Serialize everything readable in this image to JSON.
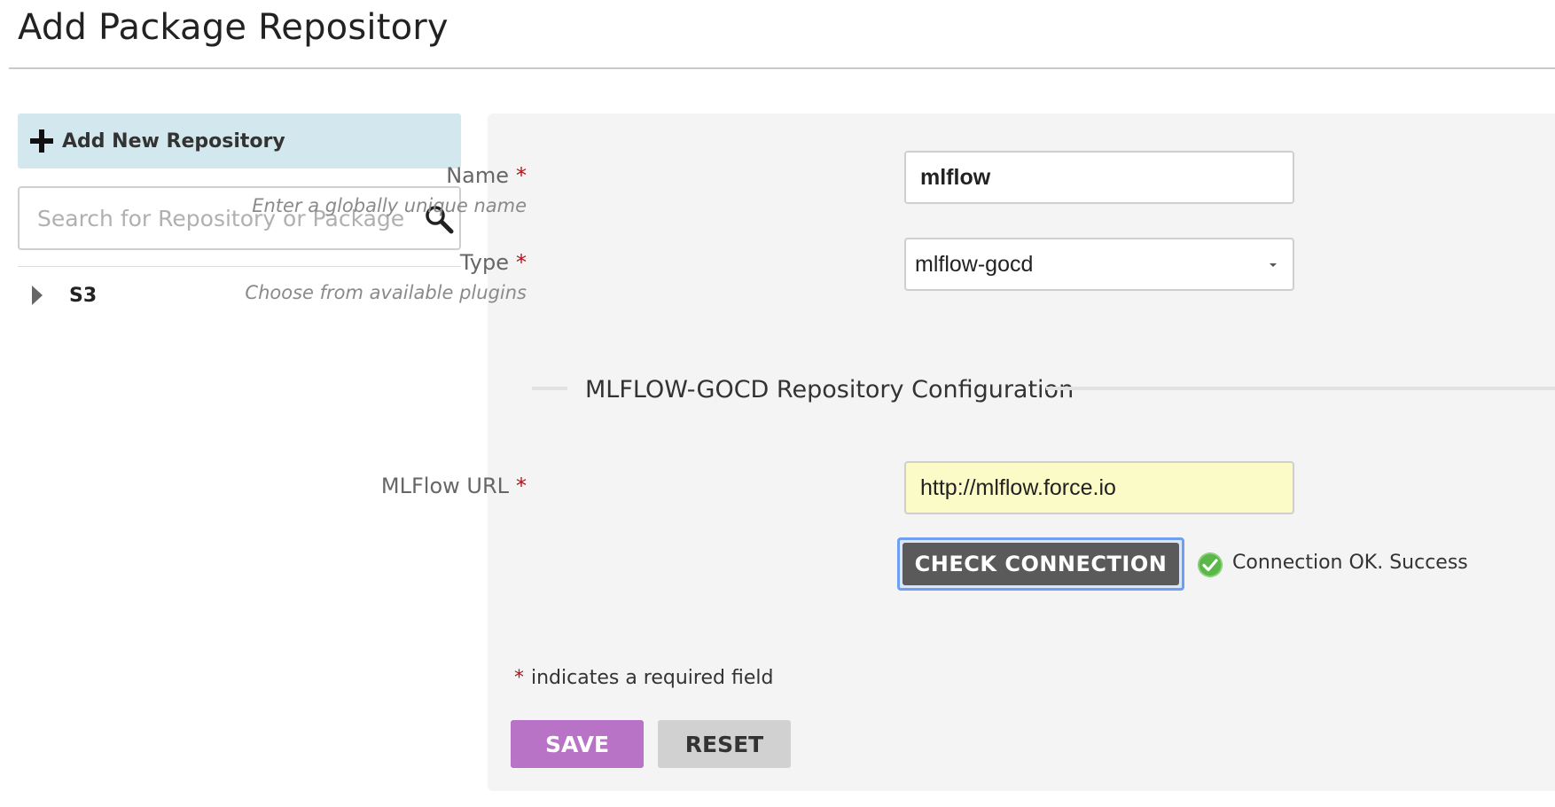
{
  "page": {
    "title": "Add Package Repository"
  },
  "sidebar": {
    "add_new_label": "Add New Repository",
    "search_placeholder": "Search for Repository or Package",
    "search_value": "",
    "tree": [
      {
        "label": "S3",
        "expanded": false
      }
    ]
  },
  "form": {
    "name": {
      "label": "Name",
      "required_marker": "*",
      "hint": "Enter a globally unique name",
      "value": "mlflow"
    },
    "type": {
      "label": "Type",
      "required_marker": "*",
      "hint": "Choose from available plugins",
      "selected": "mlflow-gocd"
    },
    "section_title": "MLFLOW-GOCD Repository Configuration",
    "url": {
      "label": "MLFlow URL",
      "required_marker": "*",
      "value": "http://mlflow.force.io"
    },
    "check_connection_label": "CHECK CONNECTION",
    "status": {
      "text": "Connection OK. Success",
      "icon": "check-circle-icon",
      "color": "#5bb848"
    },
    "required_note": {
      "marker": "*",
      "text": "indicates a required field"
    },
    "save_label": "SAVE",
    "reset_label": "RESET"
  },
  "colors": {
    "accent_save": "#b872c6",
    "add_new_bg": "#d3e8ee",
    "required_marker": "#b0141c",
    "url_field_bg": "#fbfbc8",
    "check_button_bg": "#5a5a5a"
  }
}
